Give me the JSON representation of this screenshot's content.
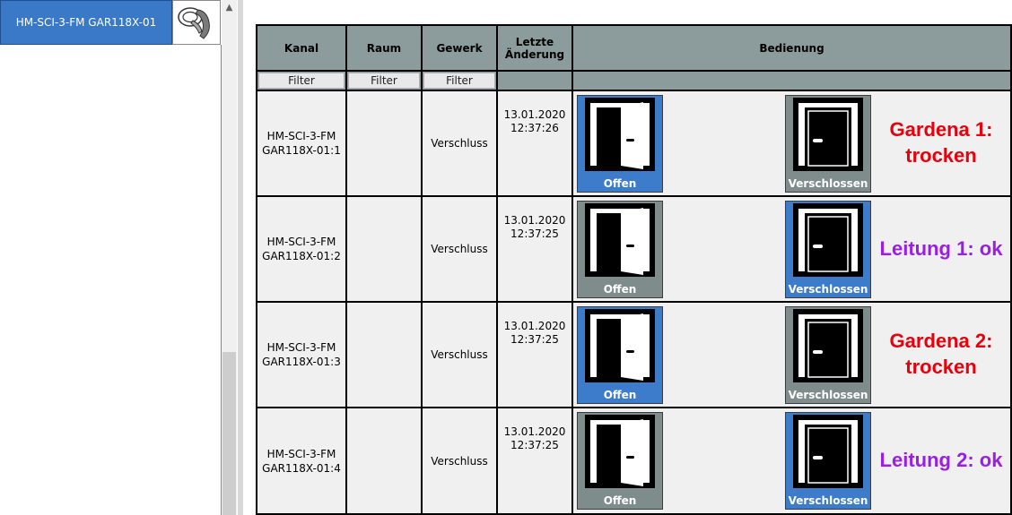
{
  "sidebar": {
    "device_tab": "HM-SCI-3-FM GAR118X-01",
    "device_icon": "dryness-sensor-icon"
  },
  "table": {
    "headers": {
      "kanal": "Kanal",
      "raum": "Raum",
      "gewerk": "Gewerk",
      "letzte_aenderung": "Letzte Änderung",
      "bedienung": "Bedienung"
    },
    "filter_label": "Filter",
    "rows": [
      {
        "kanal": "HM-SCI-3-FM GAR118X-01:1",
        "raum": "",
        "gewerk": "Verschluss",
        "date": "13.01.2020",
        "time": "12:37:26",
        "open_label": "Offen",
        "closed_label": "Verschlossen",
        "active": "open",
        "status_text": "Gardena 1: trocken",
        "status_color": "#e8000c"
      },
      {
        "kanal": "HM-SCI-3-FM GAR118X-01:2",
        "raum": "",
        "gewerk": "Verschluss",
        "date": "13.01.2020",
        "time": "12:37:25",
        "open_label": "Offen",
        "closed_label": "Verschlossen",
        "active": "closed",
        "status_text": "Leitung 1: ok",
        "status_color": "#9a1ee6"
      },
      {
        "kanal": "HM-SCI-3-FM GAR118X-01:3",
        "raum": "",
        "gewerk": "Verschluss",
        "date": "13.01.2020",
        "time": "12:37:25",
        "open_label": "Offen",
        "closed_label": "Verschlossen",
        "active": "open",
        "status_text": "Gardena 2: trocken",
        "status_color": "#e8000c"
      },
      {
        "kanal": "HM-SCI-3-FM GAR118X-01:4",
        "raum": "",
        "gewerk": "Verschluss",
        "date": "13.01.2020",
        "time": "12:37:25",
        "open_label": "Offen",
        "closed_label": "Verschlossen",
        "active": "closed",
        "status_text": "Leitung 2: ok",
        "status_color": "#9a1ee6"
      }
    ]
  },
  "colors": {
    "active_button": "#3c7cca",
    "inactive_button": "#7f8c8c",
    "header_bg": "#8c9c9c",
    "device_tab_bg": "#3a78c8"
  }
}
